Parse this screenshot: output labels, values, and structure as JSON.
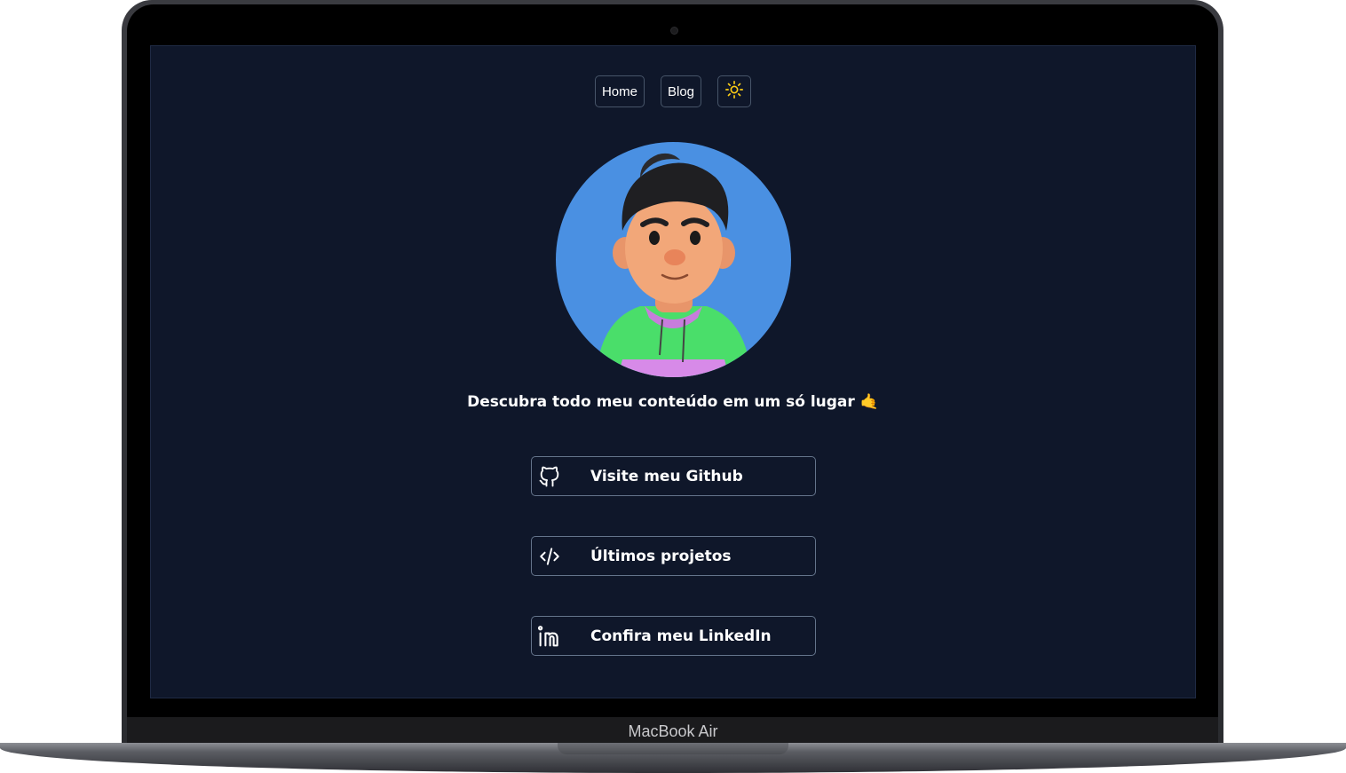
{
  "device": {
    "label": "MacBook Air"
  },
  "nav": {
    "home_label": "Home",
    "blog_label": "Blog",
    "theme_icon": "sun-icon"
  },
  "profile": {
    "avatar": "avatar-3d-character",
    "tagline": "Descubra todo meu conteúdo em um só lugar 🤙"
  },
  "links": [
    {
      "label": "Visite meu Github",
      "icon": "github-icon"
    },
    {
      "label": "Últimos projetos",
      "icon": "code-icon"
    },
    {
      "label": "Confira meu LinkedIn",
      "icon": "linkedin-icon"
    }
  ],
  "colors": {
    "background": "#0f172a",
    "border": "#475569",
    "avatar_bg": "#4a90e2",
    "sun": "#facc15",
    "text": "#ffffff"
  }
}
